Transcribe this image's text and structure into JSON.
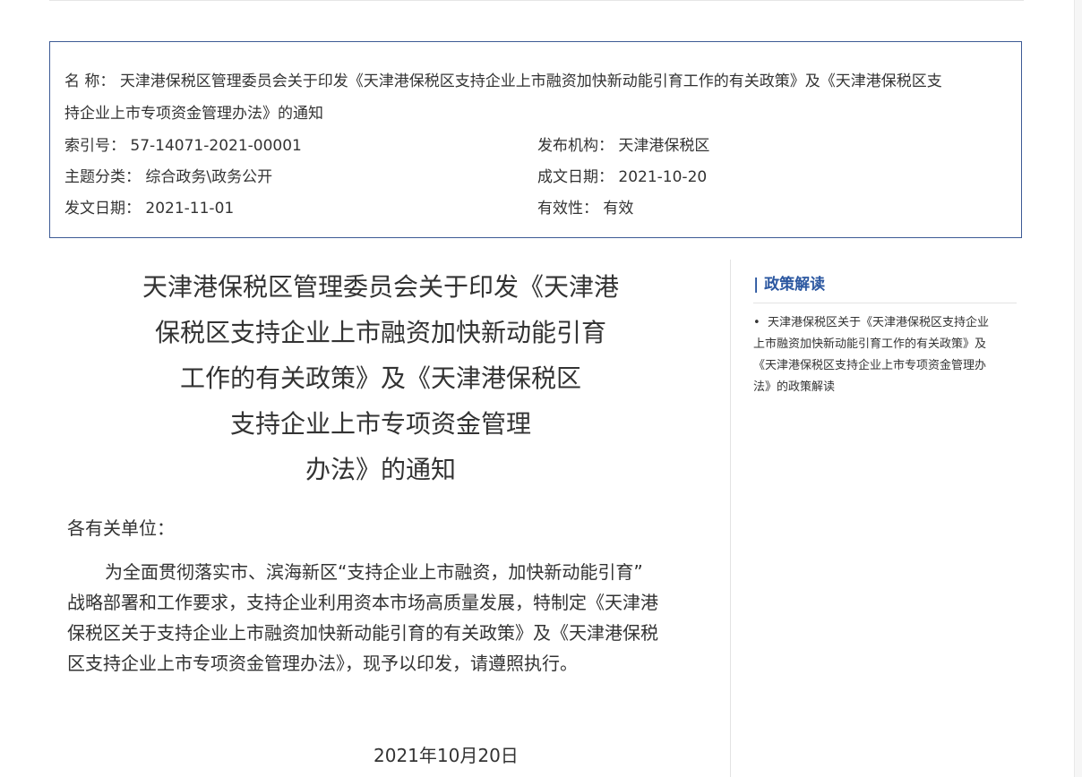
{
  "meta": {
    "name_label": "名  称：",
    "name_line1": "天津港保税区管理委员会关于印发《天津港保税区支持企业上市融资加快新动能引育工作的有关政策》及《天津港保税区支",
    "name_line2": "持企业上市专项资金管理办法》的通知",
    "index_label": "索引号：",
    "index_value": "57-14071-2021-00001",
    "issuer_label": "发布机构：",
    "issuer_value": "天津港保税区",
    "topic_label": "主题分类：",
    "topic_value": "综合政务\\政务公开",
    "written_label": "成文日期：",
    "written_value": "2021-10-20",
    "published_label": "发文日期：",
    "published_value": "2021-11-01",
    "validity_label": "有效性：",
    "validity_value": "有效"
  },
  "document": {
    "title_lines": [
      "天津港保税区管理委员会关于印发《天津港",
      "保税区支持企业上市融资加快新动能引育",
      "工作的有关政策》及《天津港保税区",
      "支持企业上市专项资金管理",
      "办法》的通知"
    ],
    "salutation": "各有关单位：",
    "body_lines": [
      "为全面贯彻落实市、滨海新区“支持企业上市融资，加快新动能引育”",
      "战略部署和工作要求，支持企业利用资本市场高质量发展，特制定《天津港",
      "保税区关于支持企业上市融资加快新动能引育的有关政策》及《天津港保税",
      "区支持企业上市专项资金管理办法》，现予以印发，请遵照执行。"
    ],
    "date": "2021年10月20日"
  },
  "sidebar": {
    "heading": "| 政策解读",
    "bullet": "•",
    "item_lines": [
      "天津港保税区关于《天津港保税区支持企业",
      "上市融资加快新动能引育工作的有关政策》及",
      "《天津港保税区支持企业上市专项资金管理办",
      "法》的政策解读"
    ]
  }
}
